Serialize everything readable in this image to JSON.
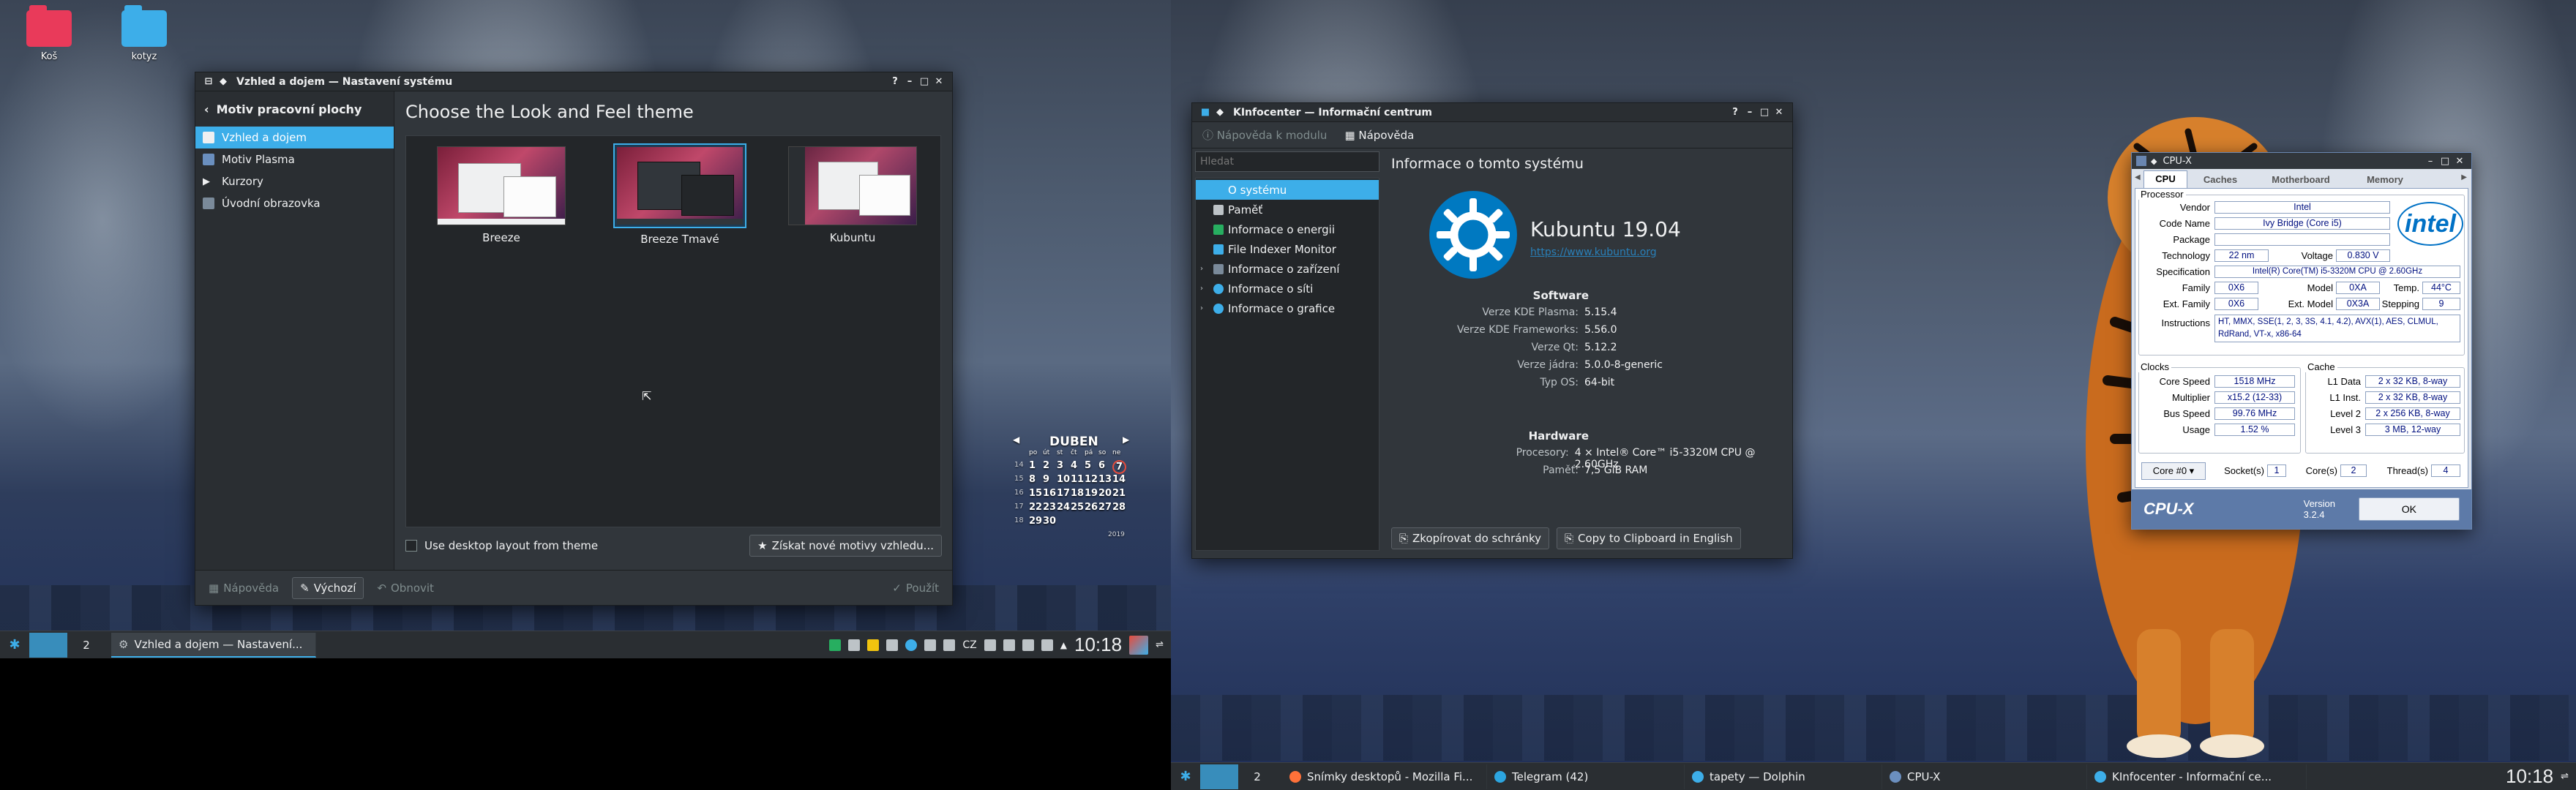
{
  "left": {
    "desktop_icons": [
      {
        "label": "Koš",
        "color": "#e93a5a"
      },
      {
        "label": "kotyz",
        "color": "#3daee9"
      }
    ],
    "settings_window": {
      "title": "Vzhled a dojem — Nastavení systému",
      "back_label": "Motiv pracovní plochy",
      "sidebar": [
        {
          "label": "Vzhled a dojem",
          "icon": "look-feel-icon",
          "selected": true
        },
        {
          "label": "Motiv Plasma",
          "icon": "plasma-theme-icon"
        },
        {
          "label": "Kurzory",
          "icon": "cursor-icon"
        },
        {
          "label": "Úvodní obrazovka",
          "icon": "splash-screen-icon"
        }
      ],
      "heading": "Choose the Look and Feel theme",
      "themes": [
        {
          "label": "Breeze",
          "selected": false
        },
        {
          "label": "Breeze Tmavé",
          "selected": true
        },
        {
          "label": "Kubuntu",
          "selected": false
        }
      ],
      "checkbox_label": "Use desktop layout from theme",
      "get_new_label": "Získat nové motivy vzhledu...",
      "help_label": "Nápověda",
      "defaults_label": "Výchozí",
      "reset_label": "Obnovit",
      "apply_label": "Použít"
    },
    "calendar": {
      "month": "DUBEN",
      "weekdays": [
        "po",
        "út",
        "st",
        "čt",
        "pá",
        "so",
        "ne"
      ],
      "rows": [
        [
          "1",
          "2",
          "3",
          "4",
          "5",
          "6",
          "7"
        ],
        [
          "8",
          "9",
          "10",
          "11",
          "12",
          "13",
          "14"
        ],
        [
          "15",
          "16",
          "17",
          "18",
          "19",
          "20",
          "21"
        ],
        [
          "22",
          "23",
          "24",
          "25",
          "26",
          "27",
          "28"
        ],
        [
          "29",
          "30",
          "",
          "",
          "",
          "",
          ""
        ]
      ],
      "week_numbers": [
        "14",
        "15",
        "16",
        "17",
        "18"
      ],
      "year": "2019",
      "today": "7"
    },
    "taskbar": {
      "page_2": "2",
      "task_label": "Vzhled a dojem  — Nastavení...",
      "lang": "CZ",
      "clock": "10:18"
    }
  },
  "right": {
    "kinfocenter": {
      "title": "KInfocenter — Informační centrum",
      "toolbar_help": "Nápověda k modulu",
      "toolbar_help2": "Nápověda",
      "search_placeholder": "Hledat",
      "tree": [
        {
          "label": "O systému",
          "selected": true,
          "expandable": false
        },
        {
          "label": "Paměť",
          "expandable": false
        },
        {
          "label": "Informace o energii",
          "expandable": false
        },
        {
          "label": "File Indexer Monitor",
          "expandable": false
        },
        {
          "label": "Informace o zařízení",
          "expandable": true
        },
        {
          "label": "Informace o síti",
          "expandable": true
        },
        {
          "label": "Informace o grafice",
          "expandable": true
        }
      ],
      "heading": "Informace o tomto systému",
      "distro": "Kubuntu 19.04",
      "url": "https://www.kubuntu.org",
      "software_title": "Software",
      "software": [
        {
          "k": "Verze KDE Plasma:",
          "v": "5.15.4"
        },
        {
          "k": "Verze KDE Frameworks:",
          "v": "5.56.0"
        },
        {
          "k": "Verze Qt:",
          "v": "5.12.2"
        },
        {
          "k": "Verze jádra:",
          "v": "5.0.0-8-generic"
        },
        {
          "k": "Typ OS:",
          "v": "64-bit"
        }
      ],
      "hardware_title": "Hardware",
      "hardware": [
        {
          "k": "Procesory:",
          "v": "4 × Intel® Core™ i5-3320M CPU @ 2.60GHz"
        },
        {
          "k": "Paměť:",
          "v": "7,5 GiB RAM"
        }
      ],
      "copy_label": "Zkopírovat do schránky",
      "copy_en_label": "Copy to Clipboard in English"
    },
    "cpuz": {
      "title": "CPU-X",
      "tabs": [
        "CPU",
        "Caches",
        "Motherboard",
        "Memory"
      ],
      "processor_title": "Processor",
      "vendor": "Intel",
      "code_name": "Ivy Bridge (Core i5)",
      "package": "",
      "technology": "22 nm",
      "voltage": "0.830 V",
      "specification": "Intel(R) Core(TM) i5-3320M CPU @ 2.60GHz",
      "family": "0X6",
      "model": "0XA",
      "temp": "44°C",
      "ext_family": "0X6",
      "ext_model": "0X3A",
      "stepping": "9",
      "instructions": "HT, MMX, SSE(1, 2, 3, 3S, 4.1, 4.2), AVX(1), AES, CLMUL, RdRand, VT-x, x86-64",
      "clocks_title": "Clocks",
      "core_speed": "1518 MHz",
      "multiplier": "x15.2 (12-33)",
      "bus_speed": "99.76 MHz",
      "usage": "1.52 %",
      "cache_title": "Cache",
      "l1_data": "2 x 32 KB, 8-way",
      "l1_inst": "2 x 32 KB, 8-way",
      "level2": "2 x 256 KB, 8-way",
      "level3": "3 MB, 12-way",
      "core_select": "Core #0",
      "sockets": "1",
      "cores": "2",
      "threads": "4",
      "brand": "CPU-X",
      "version": "Version 3.2.4",
      "ok_label": "OK",
      "labels": {
        "vendor": "Vendor",
        "code_name": "Code Name",
        "package": "Package",
        "technology": "Technology",
        "voltage": "Voltage",
        "specification": "Specification",
        "family": "Family",
        "model": "Model",
        "temp": "Temp.",
        "ext_family": "Ext. Family",
        "ext_model": "Ext. Model",
        "stepping": "Stepping",
        "instructions": "Instructions",
        "core_speed": "Core Speed",
        "multiplier": "Multiplier",
        "bus_speed": "Bus Speed",
        "usage": "Usage",
        "l1_data": "L1 Data",
        "l1_inst": "L1 Inst.",
        "level2": "Level 2",
        "level3": "Level 3",
        "sockets": "Socket(s)",
        "cores": "Core(s)",
        "threads": "Thread(s)",
        "intel_logo": "intel"
      }
    },
    "taskbar": {
      "page_2": "2",
      "tasks": [
        {
          "label": "Snímky desktopů - Mozilla Fi...",
          "icon": "firefox-icon",
          "color": "#ff7139"
        },
        {
          "label": "Telegram (42)",
          "icon": "telegram-icon",
          "color": "#2ca5e0"
        },
        {
          "label": "tapety — Dolphin",
          "icon": "dolphin-icon",
          "color": "#3daee9"
        },
        {
          "label": "CPU-X",
          "icon": "cpux-icon",
          "color": "#6b8fbf"
        },
        {
          "label": "KInfocenter - Informační ce...",
          "icon": "kinfocenter-icon",
          "color": "#3daee9"
        }
      ],
      "clock": "10:18"
    }
  }
}
